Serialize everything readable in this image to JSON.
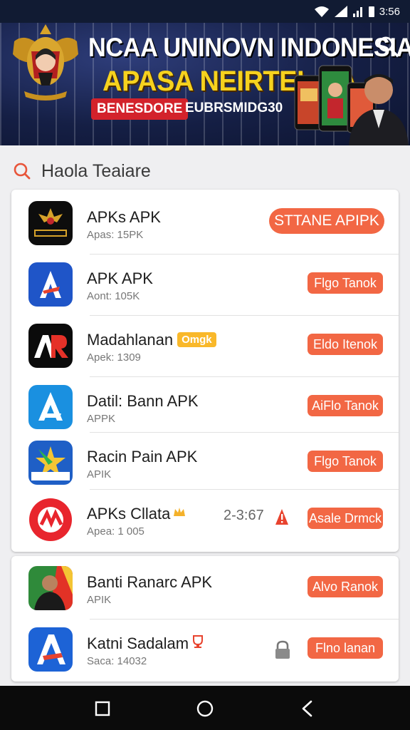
{
  "status_bar": {
    "time": "3:56"
  },
  "banner": {
    "title_line1": "NCAA UNINOVN INDONESIA",
    "title_line2": "APASA NEIRTEL AA",
    "pill_label": "BENESDORE",
    "pill_text": "EUBRSMIDG30"
  },
  "search": {
    "label": "Haola Teaiare"
  },
  "apps": [
    {
      "name": "APKs APK",
      "meta": "Apas: 15PK",
      "button": "STTANE APIPK"
    },
    {
      "name": "APK APK",
      "meta": "Aont: 105K",
      "button": "Flgo Tanok"
    },
    {
      "name": "Madahlanan",
      "badge": "Omgk",
      "meta": "Apek: 1309",
      "button": "Eldo Itenok"
    },
    {
      "name": "Datil: Bann APK",
      "meta": "APPK",
      "button": "AiFlo Tanok"
    },
    {
      "name": "Racin Pain APK",
      "meta": "APIK",
      "button": "Flgo Tanok"
    },
    {
      "name": "APKs Cllata",
      "meta": "Apea: 1 005",
      "ticker": "2-3:67",
      "button": "Asale Drmck"
    },
    {
      "name": "Banti Ranarc APK",
      "meta": "APIK",
      "button": "Alvo Ranok"
    },
    {
      "name": "Katni Sadalam",
      "meta": "Saca: 14032",
      "button": "Flno lanan"
    }
  ],
  "colors": {
    "accent": "#f26744",
    "banner_bg": "#151f45",
    "title_yellow": "#f6d21e"
  }
}
